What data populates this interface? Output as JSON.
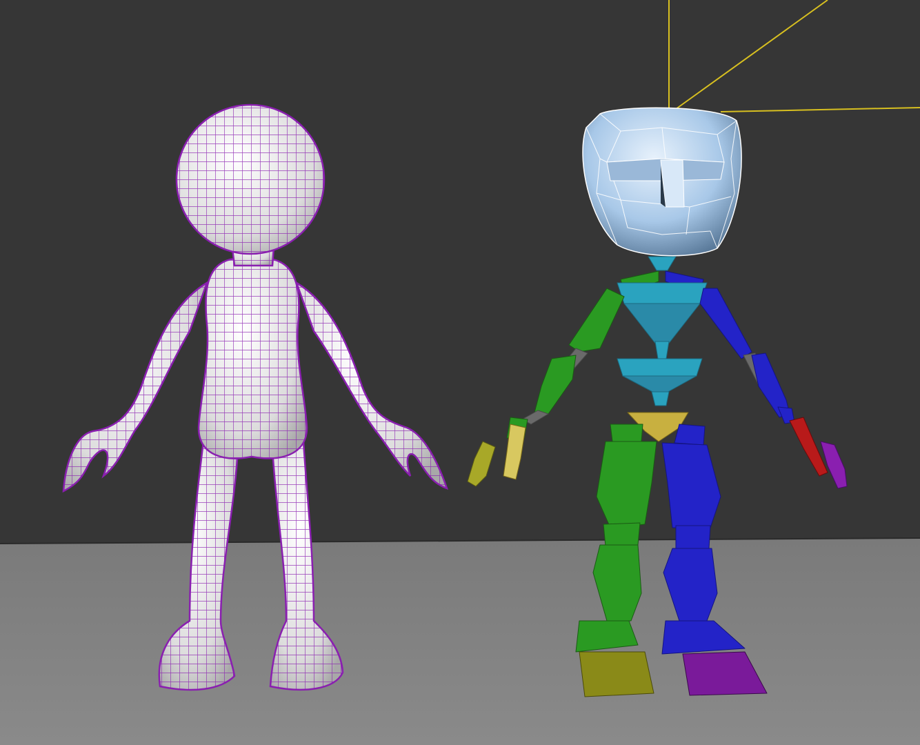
{
  "viewport": {
    "background_color": "#363636",
    "floor_color": "#808080",
    "horizon_color": "#2a2a2a"
  },
  "objects": {
    "character_mesh": {
      "type": "wireframe-mesh",
      "shading": "white-with-purple-wires",
      "wire_color": "#8a1fb0",
      "fill_color": "#efefef"
    },
    "biped_rig": {
      "type": "skeleton",
      "head_color": "#a8c8e8",
      "spine_color": "#2aa3bf",
      "left_side_color": "#2a9a22",
      "right_side_color": "#2323c8",
      "pelvis_color": "#c8b040",
      "left_finger_color": "#d8c860",
      "left_thumb_color": "#a8a828",
      "right_finger_color": "#b81a1a",
      "right_thumb_color": "#8a1fb0",
      "left_foot_color": "#8a8a18",
      "right_foot_color": "#7a1a9a"
    },
    "light_lines": {
      "color": "#d8c020"
    }
  }
}
